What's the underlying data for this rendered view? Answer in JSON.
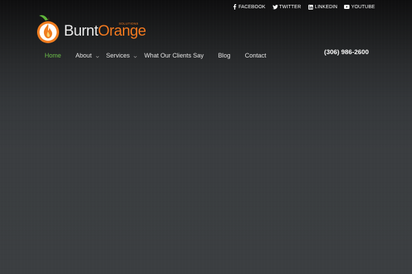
{
  "social": [
    {
      "label": "FACEBOOK",
      "icon": "facebook-icon"
    },
    {
      "label": "TWITTER",
      "icon": "twitter-icon"
    },
    {
      "label": "LINKEDIN",
      "icon": "linkedin-icon"
    },
    {
      "label": "YOUTUBE",
      "icon": "youtube-icon"
    }
  ],
  "logo": {
    "word_part1": "Burnt",
    "word_part2": "Orange",
    "tagline": "SOLUTIONS",
    "icon": "orange-flame-logo-icon"
  },
  "nav": [
    {
      "label": "Home",
      "active": true,
      "has_dropdown": false
    },
    {
      "label": "About",
      "active": false,
      "has_dropdown": true
    },
    {
      "label": "Services",
      "active": false,
      "has_dropdown": true
    },
    {
      "label": "What Our Clients Say",
      "active": false,
      "has_dropdown": false
    },
    {
      "label": "Blog",
      "active": false,
      "has_dropdown": false
    },
    {
      "label": "Contact",
      "active": false,
      "has_dropdown": false
    }
  ],
  "phone": "(306) 986-2600",
  "colors": {
    "brand_orange": "#f0781f",
    "active_green": "#6cc04a",
    "background": "#3a3d40"
  }
}
